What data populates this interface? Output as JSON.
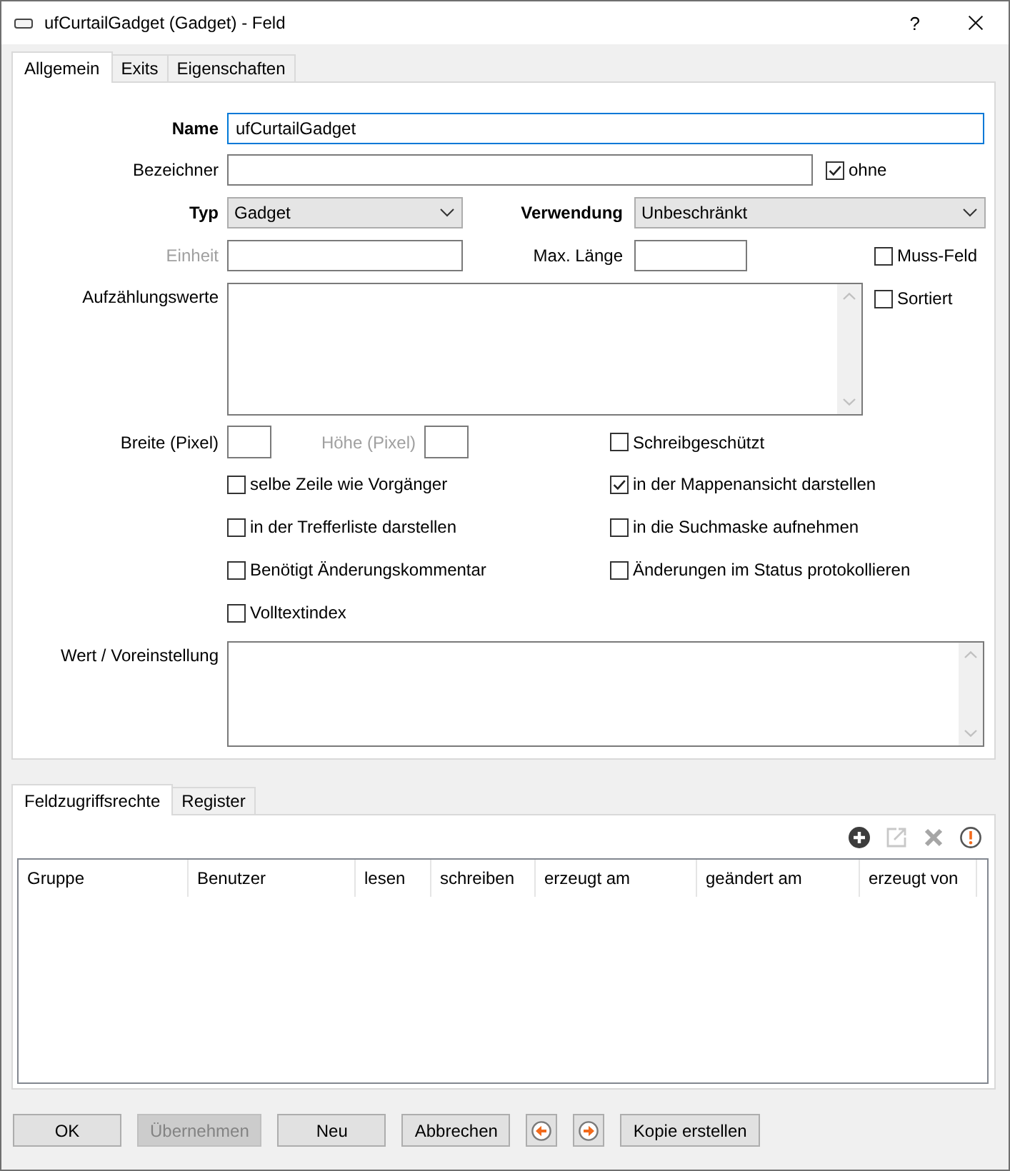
{
  "window": {
    "title": "ufCurtailGadget (Gadget) - Feld",
    "help_button": "?"
  },
  "tabs": [
    {
      "label": "Allgemein",
      "selected": true
    },
    {
      "label": "Exits",
      "selected": false
    },
    {
      "label": "Eigenschaften",
      "selected": false
    }
  ],
  "general": {
    "name": {
      "label": "Name",
      "value": "ufCurtailGadget",
      "mandatory": true,
      "focused": true
    },
    "designator": {
      "label": "Bezeichner",
      "mandatory": false,
      "option": {
        "label": "ohne",
        "checked": true
      }
    },
    "type": {
      "label": "Typ",
      "value": "Gadget",
      "mandatory": true
    },
    "usage": {
      "label": "Verwendung",
      "value": "Unbeschränkt",
      "mandatory": true
    },
    "unit": {
      "label": "Einheit",
      "disabled": true
    },
    "max_length": {
      "label": "Max. Länge",
      "disabled": false
    },
    "required": {
      "label": "Muss-Feld",
      "checked": false
    },
    "enum_values": {
      "label": "Aufzählungswerte"
    },
    "sorted": {
      "label": "Sortiert",
      "checked": false
    },
    "width": {
      "label": "Breite (Pixel)",
      "disabled": false
    },
    "height": {
      "label": "Höhe (Pixel)",
      "disabled": true
    },
    "options_left": [
      {
        "label": "selbe Zeile wie Vorgänger",
        "checked": false
      },
      {
        "label": "in der Trefferliste darstellen",
        "checked": false
      },
      {
        "label": "Benötigt Änderungskommentar",
        "checked": false
      },
      {
        "label": "Volltextindex",
        "checked": false
      }
    ],
    "options_right": [
      {
        "label": "Schreibgeschützt",
        "checked": false
      },
      {
        "label": "in der Mappenansicht darstellen",
        "checked": true
      },
      {
        "label": "in die Suchmaske aufnehmen",
        "checked": false
      },
      {
        "label": "Änderungen im Status protokollieren",
        "checked": false
      }
    ],
    "default_value": {
      "label": "Wert / Voreinstellung"
    }
  },
  "access_tabs": [
    {
      "label": "Feldzugriffsrechte",
      "selected": true
    },
    {
      "label": "Register",
      "selected": false
    }
  ],
  "toolbar": [
    {
      "kind": "add",
      "disabled": false
    },
    {
      "kind": "edit",
      "disabled": true
    },
    {
      "kind": "delete",
      "disabled": true
    },
    {
      "kind": "warning",
      "disabled": false
    }
  ],
  "table": {
    "columns": [
      "Gruppe",
      "Benutzer",
      "lesen",
      "schreiben",
      "erzeugt am",
      "geändert am",
      "erzeugt von"
    ]
  },
  "buttons": [
    {
      "kind": "text",
      "label": "OK",
      "disabled": false
    },
    {
      "kind": "text",
      "label": "Übernehmen",
      "disabled": true
    },
    {
      "kind": "text",
      "label": "Neu",
      "disabled": false
    },
    {
      "kind": "text",
      "label": "Abbrechen",
      "disabled": false
    },
    {
      "kind": "previous",
      "disabled": false
    },
    {
      "kind": "next",
      "disabled": false
    },
    {
      "kind": "text",
      "label": "Kopie erstellen",
      "disabled": false
    }
  ]
}
